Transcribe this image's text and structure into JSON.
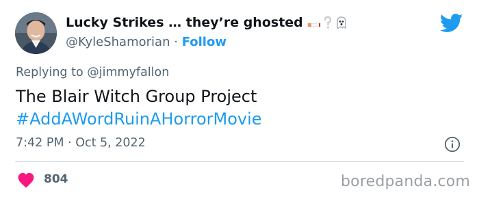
{
  "author": {
    "display_name": "Lucky Strikes … they’re ghosted",
    "handle": "@KyleShamorian",
    "separator": "·",
    "follow_label": "Follow"
  },
  "reply": {
    "prefix": "Replying to",
    "mention": "@jimmyfallon"
  },
  "tweet": {
    "text_line1": "The Blair Witch Group Project",
    "hashtag": "#AddAWordRuinAHorrorMovie",
    "timestamp": "7:42 PM · Oct 5, 2022"
  },
  "engagement": {
    "likes": "804"
  },
  "watermark": "boredpanda.com",
  "icons": {
    "platform": "twitter-bird-icon",
    "info": "info-icon",
    "like": "heart-icon",
    "emoji": [
      "cigarette-icon",
      "question-mark-icon",
      "ghost-icon"
    ]
  },
  "colors": {
    "accent": "#1d9bf0",
    "like": "#f91880",
    "text": "#0f1419",
    "secondary": "#536471"
  }
}
